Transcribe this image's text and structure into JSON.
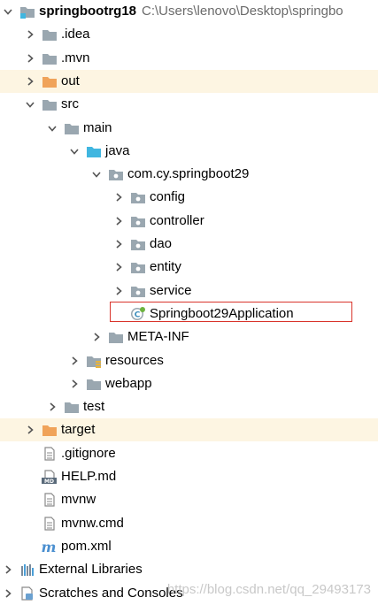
{
  "tree": [
    {
      "label": "springbootrg18",
      "path": "C:\\Users\\lenovo\\Desktop\\springbo",
      "depth": 0,
      "arrow": "down",
      "icon": "module-folder-icon",
      "bold": true
    },
    {
      "label": ".idea",
      "depth": 1,
      "arrow": "right",
      "icon": "folder-icon"
    },
    {
      "label": ".mvn",
      "depth": 1,
      "arrow": "right",
      "icon": "folder-icon"
    },
    {
      "label": "out",
      "depth": 1,
      "arrow": "right",
      "icon": "excluded-folder-icon",
      "highlight": true
    },
    {
      "label": "src",
      "depth": 1,
      "arrow": "down",
      "icon": "folder-icon"
    },
    {
      "label": "main",
      "depth": 2,
      "arrow": "down",
      "icon": "folder-icon"
    },
    {
      "label": "java",
      "depth": 3,
      "arrow": "down",
      "icon": "source-folder-icon"
    },
    {
      "label": "com.cy.springboot29",
      "depth": 4,
      "arrow": "down",
      "icon": "package-icon"
    },
    {
      "label": "config",
      "depth": 5,
      "arrow": "right",
      "icon": "package-icon"
    },
    {
      "label": "controller",
      "depth": 5,
      "arrow": "right",
      "icon": "package-icon"
    },
    {
      "label": "dao",
      "depth": 5,
      "arrow": "right",
      "icon": "package-icon"
    },
    {
      "label": "entity",
      "depth": 5,
      "arrow": "right",
      "icon": "package-icon"
    },
    {
      "label": "service",
      "depth": 5,
      "arrow": "right",
      "icon": "package-icon"
    },
    {
      "label": "Springboot29Application",
      "depth": 5,
      "arrow": "none",
      "icon": "spring-boot-class-icon",
      "selected": true
    },
    {
      "label": "META-INF",
      "depth": 4,
      "arrow": "right",
      "icon": "folder-icon"
    },
    {
      "label": "resources",
      "depth": 3,
      "arrow": "right",
      "icon": "resources-folder-icon"
    },
    {
      "label": "webapp",
      "depth": 3,
      "arrow": "right",
      "icon": "folder-icon"
    },
    {
      "label": "test",
      "depth": 2,
      "arrow": "right",
      "icon": "folder-icon"
    },
    {
      "label": "target",
      "depth": 1,
      "arrow": "right",
      "icon": "excluded-folder-icon",
      "highlight": true
    },
    {
      "label": ".gitignore",
      "depth": 1,
      "arrow": "none",
      "icon": "text-file-icon"
    },
    {
      "label": "HELP.md",
      "depth": 1,
      "arrow": "none",
      "icon": "markdown-file-icon"
    },
    {
      "label": "mvnw",
      "depth": 1,
      "arrow": "none",
      "icon": "text-file-icon"
    },
    {
      "label": "mvnw.cmd",
      "depth": 1,
      "arrow": "none",
      "icon": "text-file-icon"
    },
    {
      "label": "pom.xml",
      "depth": 1,
      "arrow": "none",
      "icon": "maven-file-icon"
    },
    {
      "label": "External Libraries",
      "depth": 0,
      "arrow": "right",
      "icon": "libraries-icon"
    },
    {
      "label": "Scratches and Consoles",
      "depth": 0,
      "arrow": "right",
      "icon": "scratches-icon"
    }
  ],
  "watermark": "https://blog.csdn.net/qq_29493173",
  "colors": {
    "folder": "#9aa7b0",
    "source_folder": "#40b6e0",
    "excluded_folder": "#f0a35a",
    "highlight_row": "#fdf5e2",
    "selection_border": "#d9342b",
    "spring": "#6db33f"
  }
}
